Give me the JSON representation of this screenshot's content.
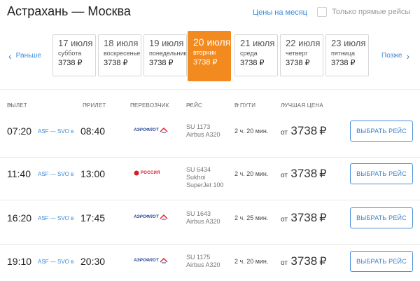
{
  "header": {
    "title": "Астрахань — Москва",
    "month_prices_link": "Цены на месяц",
    "direct_only_label": "Только прямые рейсы"
  },
  "date_nav": {
    "prev_label": "Раньше",
    "next_label": "Позже",
    "dates": [
      {
        "date": "17 июля",
        "weekday": "суббота",
        "price": "3738 ₽",
        "active": false
      },
      {
        "date": "18 июля",
        "weekday": "воскресенье",
        "price": "3738 ₽",
        "active": false
      },
      {
        "date": "19 июля",
        "weekday": "понедельник",
        "price": "3738 ₽",
        "active": false
      },
      {
        "date": "20 июля",
        "weekday": "вторник",
        "price": "3738 ₽",
        "active": true
      },
      {
        "date": "21 июля",
        "weekday": "среда",
        "price": "3738 ₽",
        "active": false
      },
      {
        "date": "22 июля",
        "weekday": "четверг",
        "price": "3738 ₽",
        "active": false
      },
      {
        "date": "23 июля",
        "weekday": "пятница",
        "price": "3738 ₽",
        "active": false
      }
    ]
  },
  "columns": {
    "departure": "ВЫЛЕТ",
    "arrival": "ПРИЛЕТ",
    "carrier": "ПЕРЕВОЗЧИК",
    "flight": "РЕЙС",
    "duration": "В ПУТИ",
    "best_price": "ЛУЧШАЯ ЦЕНА"
  },
  "flights": [
    {
      "dep": "07:20",
      "route": "ASF — SVO в",
      "arr": "08:40",
      "carrier": "aeroflot",
      "carrier_text": "АЭРОФЛОТ",
      "flight_no": "SU 1173",
      "aircraft": "Airbus A320",
      "duration": "2 ч. 20 мин.",
      "price_from": "от",
      "price": "3738",
      "currency": "₽",
      "button": "ВЫБРАТЬ РЕЙС"
    },
    {
      "dep": "11:40",
      "route": "ASF — SVO в",
      "arr": "13:00",
      "carrier": "rossiya",
      "carrier_text": "РОССИЯ",
      "flight_no": "SU 6434",
      "aircraft": "Sukhoi SuperJet 100",
      "duration": "2 ч. 20 мин.",
      "price_from": "от",
      "price": "3738",
      "currency": "₽",
      "button": "ВЫБРАТЬ РЕЙС"
    },
    {
      "dep": "16:20",
      "route": "ASF — SVO в",
      "arr": "17:45",
      "carrier": "aeroflot",
      "carrier_text": "АЭРОФЛОТ",
      "flight_no": "SU 1643",
      "aircraft": "Airbus A320",
      "duration": "2 ч. 25 мин.",
      "price_from": "от",
      "price": "3738",
      "currency": "₽",
      "button": "ВЫБРАТЬ РЕЙС"
    },
    {
      "dep": "19:10",
      "route": "ASF — SVO в",
      "arr": "20:30",
      "carrier": "aeroflot",
      "carrier_text": "АЭРОФЛОТ",
      "flight_no": "SU 1175",
      "aircraft": "Airbus A320",
      "duration": "2 ч. 20 мин.",
      "price_from": "от",
      "price": "3738",
      "currency": "₽",
      "button": "ВЫБРАТЬ РЕЙС"
    }
  ],
  "colors": {
    "accent": "#f28a1f",
    "link": "#3b8ad9",
    "aeroflot_blue": "#1b3f94",
    "aeroflot_red": "#e4262c",
    "rossiya_red": "#d62027"
  },
  "icons": {
    "prev": "chevron-left-icon",
    "next": "chevron-right-icon",
    "sort": "caret-down-icon"
  }
}
